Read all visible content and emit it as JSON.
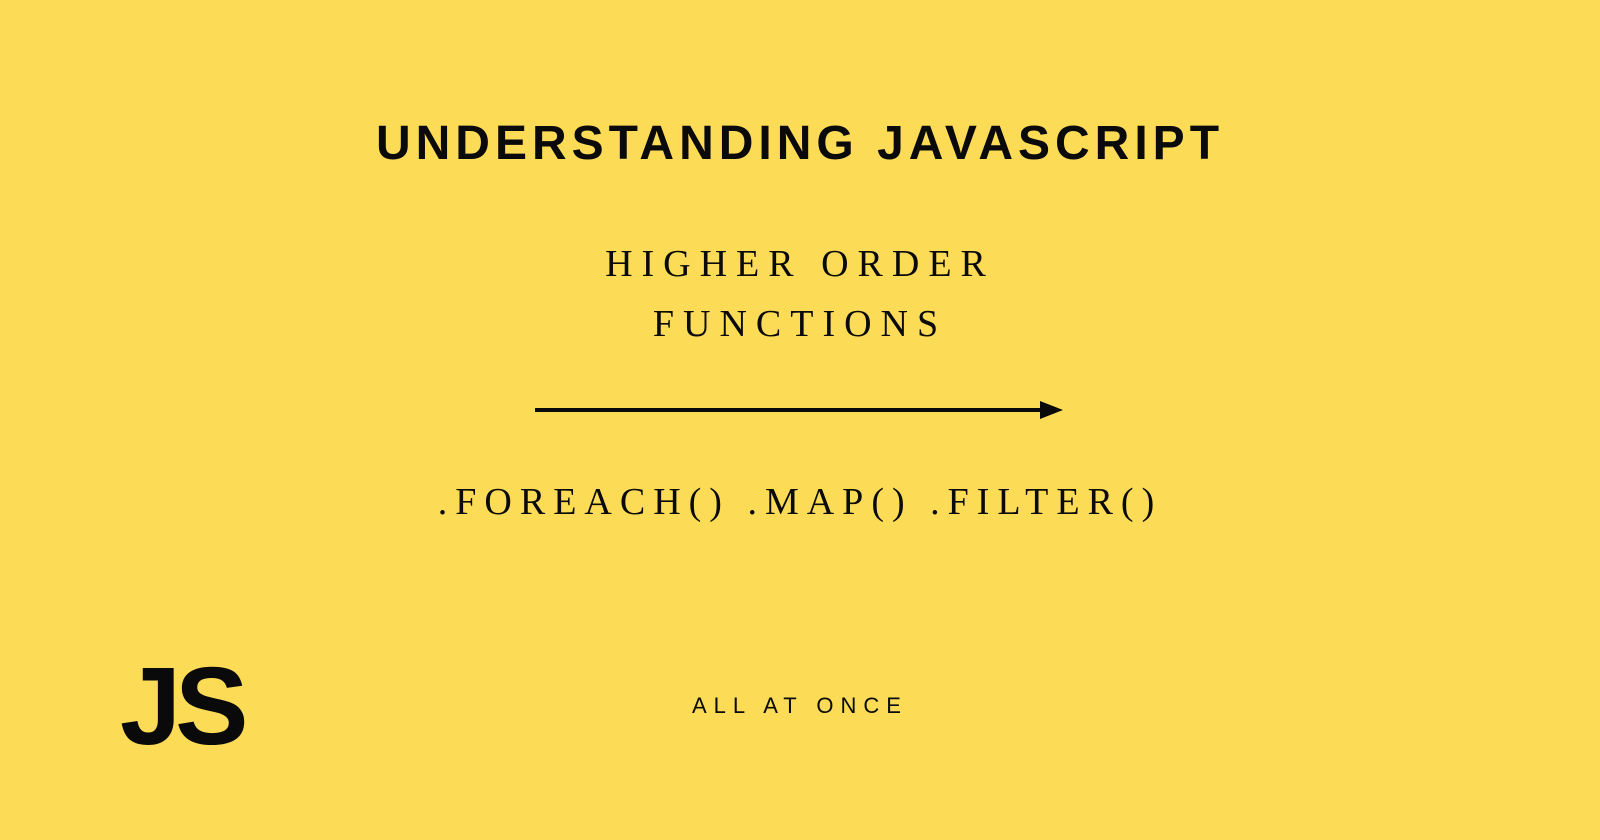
{
  "title": "UNDERSTANDING JAVASCRIPT",
  "subtitle": {
    "line1": "HIGHER ORDER",
    "line2": "FUNCTIONS"
  },
  "methods": ".FOREACH() .MAP() .FILTER()",
  "footer": "ALL AT ONCE",
  "logo": "JS",
  "colors": {
    "background": "#FCDB57",
    "text": "#0a0a0a"
  }
}
